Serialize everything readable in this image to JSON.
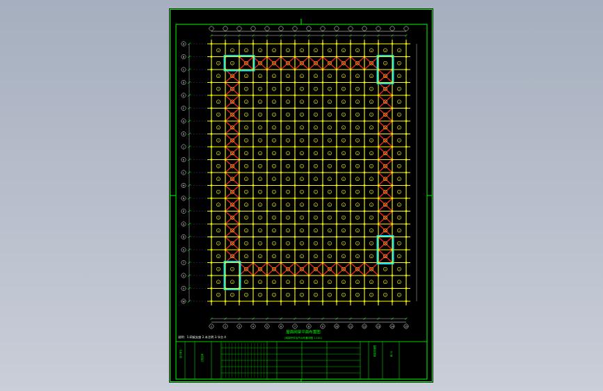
{
  "drawing": {
    "title": "屋面网架平面布置图",
    "subtitle": "(网架杆件及节点布置详图 1:100)",
    "notes_header": "说明：1.网架支座 2.未注明 3.节点 4",
    "scale_text": "1:100"
  },
  "grid": {
    "columns": [
      "1",
      "2",
      "3",
      "4",
      "5",
      "6",
      "7",
      "8",
      "9",
      "10",
      "11",
      "12",
      "13",
      "14",
      "15"
    ],
    "rows": [
      "A",
      "B",
      "C",
      "D",
      "E",
      "F",
      "G",
      "H",
      "J",
      "K",
      "L",
      "M",
      "N",
      "P",
      "Q",
      "R",
      "S",
      "T",
      "U",
      "V",
      "W"
    ],
    "column_count": 15,
    "row_count": 21
  },
  "colors": {
    "background": "#000000",
    "border": "#00ff00",
    "grid_line": "#ffff00",
    "node": "#ffff00",
    "support_highlight": "#00e5ff",
    "bracing": "#ff2020",
    "dimension": "#ffffff",
    "annotation": "#00ff00"
  },
  "title_block": {
    "design_unit": "设计单位",
    "project": "工程名称",
    "drawing_name": "网架平面图",
    "drawing_no": "网-01"
  }
}
